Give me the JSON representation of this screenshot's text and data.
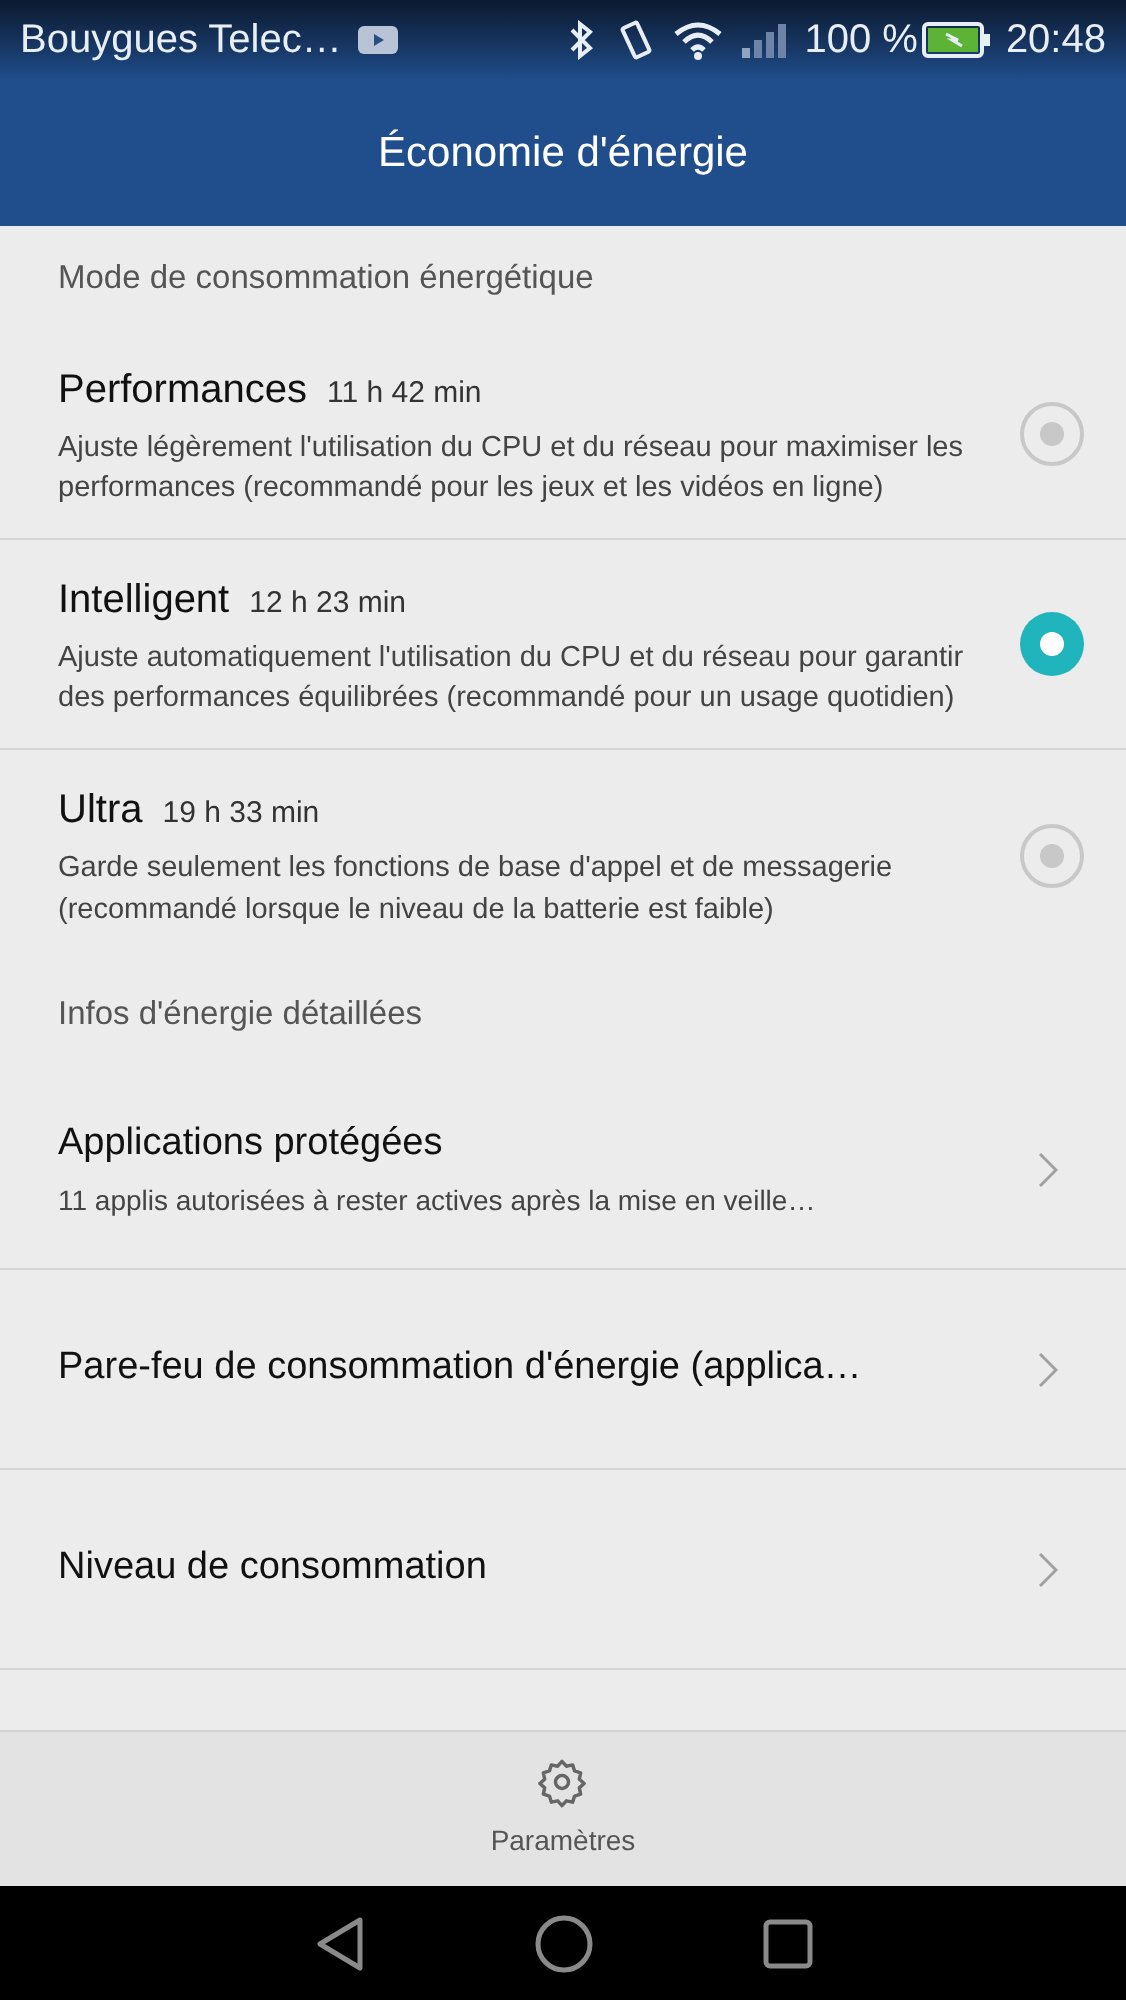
{
  "status_bar": {
    "carrier": "Bouygues Telec…",
    "battery": "100 %",
    "time": "20:48"
  },
  "app_bar": {
    "title": "Économie d'énergie"
  },
  "mode_section": {
    "title": "Mode de consommation énergétique",
    "modes": [
      {
        "name": "Performances",
        "duration": "11 h 42 min",
        "description": "Ajuste légèrement l'utilisation du CPU et du réseau pour maximiser les performances (recommandé pour les jeux et les vidéos en ligne)",
        "selected": false
      },
      {
        "name": "Intelligent",
        "duration": "12 h 23 min",
        "description": "Ajuste automatiquement l'utilisation du CPU et du réseau pour garantir des performances équilibrées (recommandé pour un usage quotidien)",
        "selected": true
      },
      {
        "name": "Ultra",
        "duration": "19 h 33 min",
        "description": "Garde seulement les fonctions de base d'appel et de messagerie (recommandé lorsque le niveau de la batterie est faible)",
        "selected": false
      }
    ]
  },
  "info_section": {
    "title": "Infos d'énergie détaillées",
    "items": [
      {
        "title": "Applications protégées",
        "subtitle": "11 applis autorisées à rester actives après la mise en veille…"
      },
      {
        "title": "Pare-feu de consommation d'énergie (applica…"
      },
      {
        "title": "Niveau de consommation"
      }
    ]
  },
  "bottom_bar": {
    "label": "Paramètres"
  }
}
